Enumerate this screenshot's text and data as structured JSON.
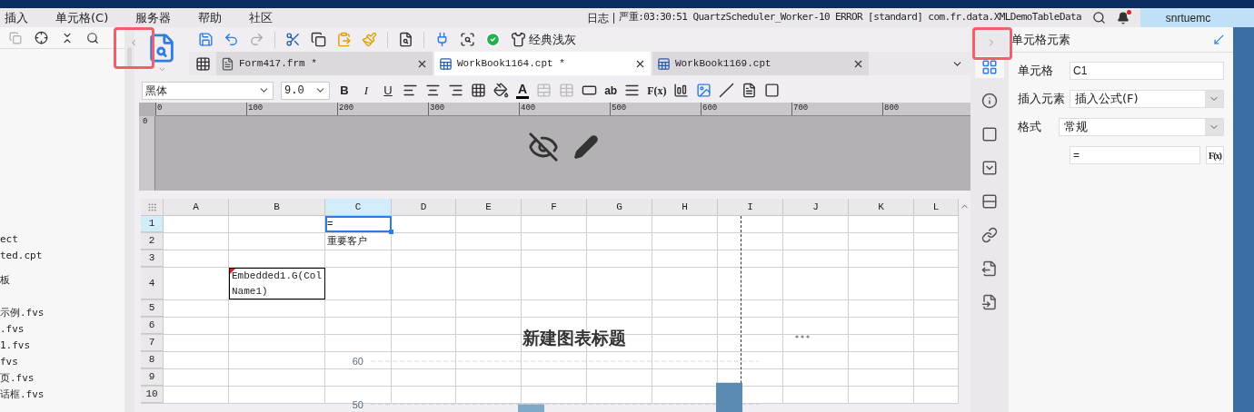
{
  "menu": [
    "插入",
    "单元格(C)",
    "服务器",
    "帮助",
    "社区"
  ],
  "status": {
    "log_label": "日志",
    "message": "严重:03:30:51 QuartzScheduler_Worker-10 ERROR [standard] com.fr.data.XMLDemoTableData",
    "notification": true,
    "user": "snrtuemc"
  },
  "explorer": {
    "items": [
      "ect",
      "ted.cpt",
      "板",
      "示例.fvs",
      ".fvs",
      "1.fvs",
      "fvs",
      "页.fvs",
      "话框.fvs"
    ]
  },
  "toolbar": {
    "theme_label": "经典浅灰"
  },
  "tabs": [
    {
      "label": "Form417.frm *",
      "kind": "form",
      "selected": false
    },
    {
      "label": "WorkBook1164.cpt *",
      "kind": "workbook",
      "selected": true
    },
    {
      "label": "WorkBook1169.cpt",
      "kind": "workbook",
      "selected": false
    }
  ],
  "format_bar": {
    "font": "黑体",
    "size": "9.0",
    "bold": "B",
    "italic": "I",
    "underline": "U",
    "font_color": "A",
    "text_label": "ab",
    "formula": "F(x)"
  },
  "ruler": {
    "marks": [
      "0",
      "100",
      "200",
      "300",
      "400",
      "500",
      "600",
      "700",
      "800"
    ],
    "vertical": "0"
  },
  "sheet": {
    "columns": [
      {
        "label": "A",
        "selected": false
      },
      {
        "label": "B",
        "selected": false
      },
      {
        "label": "C",
        "selected": true
      },
      {
        "label": "D",
        "selected": false
      },
      {
        "label": "E",
        "selected": false
      },
      {
        "label": "F",
        "selected": false
      },
      {
        "label": "G",
        "selected": false
      },
      {
        "label": "H",
        "selected": false
      },
      {
        "label": "I",
        "selected": false
      },
      {
        "label": "J",
        "selected": false
      },
      {
        "label": "K",
        "selected": false
      },
      {
        "label": "L",
        "selected": false
      }
    ],
    "rows": [
      {
        "label": "1",
        "selected": true,
        "cells": [
          null,
          null,
          {
            "text": "=",
            "kind": "plain",
            "selected": true
          }
        ]
      },
      {
        "label": "2",
        "selected": false,
        "cells": [
          null,
          null,
          {
            "text": "重要客户",
            "kind": "plain",
            "selected": false
          }
        ]
      },
      {
        "label": "3",
        "selected": false,
        "cells": []
      },
      {
        "label": "4",
        "selected": false,
        "cells": [
          null,
          {
            "text": "Embedded1.G(ColName1)",
            "kind": "formula",
            "selected": false
          }
        ]
      },
      {
        "label": "5",
        "selected": false,
        "cells": []
      },
      {
        "label": "6",
        "selected": false,
        "cells": []
      },
      {
        "label": "7",
        "selected": false,
        "cells": []
      },
      {
        "label": "8",
        "selected": false,
        "cells": []
      },
      {
        "label": "9",
        "selected": false,
        "cells": []
      },
      {
        "label": "10",
        "selected": false,
        "cells": []
      }
    ],
    "chart": {
      "chart_data": {
        "type": "bar",
        "title": "新建图表标题",
        "values": [
          50,
          55
        ],
        "ylim": [
          48,
          60
        ],
        "yticks": [
          50,
          60
        ]
      }
    }
  },
  "side_tabs": [
    {
      "selected": true
    },
    {
      "selected": false
    },
    {
      "selected": false
    },
    {
      "selected": false
    },
    {
      "selected": false
    },
    {
      "selected": false
    },
    {
      "selected": false
    },
    {
      "selected": false
    }
  ],
  "panel": {
    "title": "单元格元素",
    "fields": [
      {
        "label": "单元格",
        "value": "C1",
        "kind": "text"
      },
      {
        "label": "插入元素",
        "value": "插入公式(F)",
        "kind": "select"
      },
      {
        "label": "格式",
        "value": "常规",
        "kind": "select"
      },
      {
        "value": "=",
        "kind": "formula",
        "button": "F(x)"
      }
    ]
  }
}
